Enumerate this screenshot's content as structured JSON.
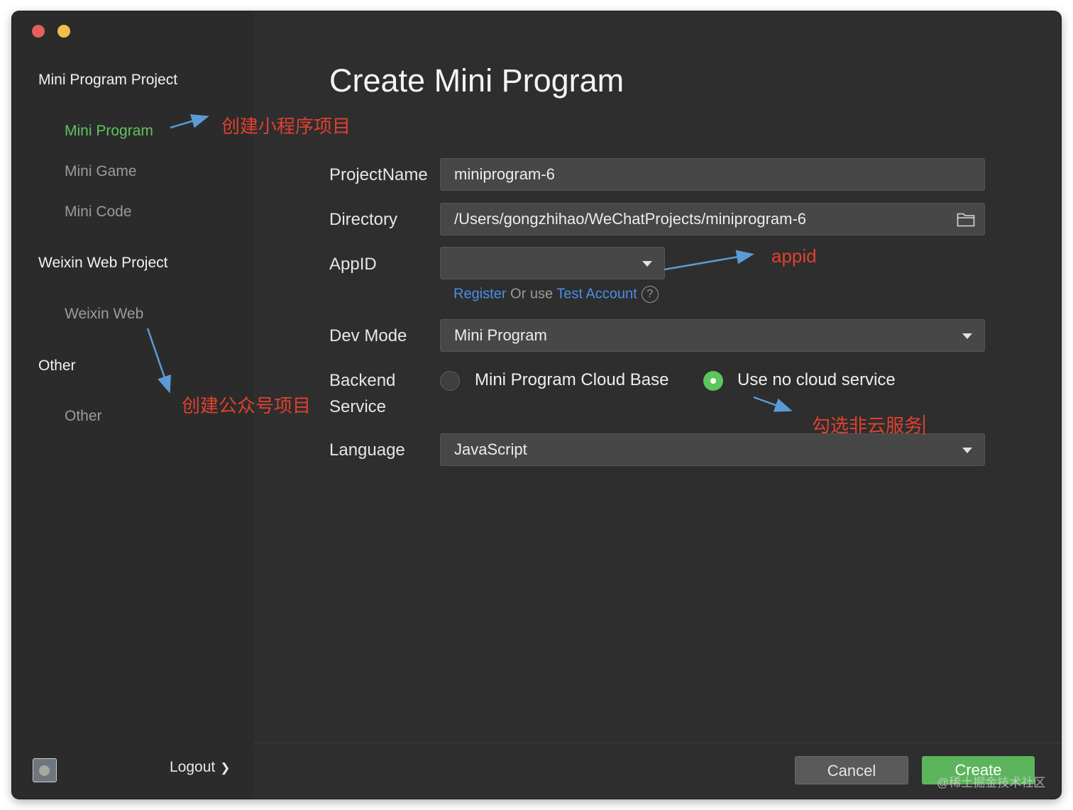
{
  "sidebar": {
    "groups": [
      {
        "title": "Mini Program Project",
        "items": [
          "Mini Program",
          "Mini Game",
          "Mini Code"
        ]
      },
      {
        "title": "Weixin Web Project",
        "items": [
          "Weixin Web"
        ]
      },
      {
        "title": "Other",
        "items": [
          "Other"
        ]
      }
    ],
    "active_item": "Mini Program",
    "logout_label": "Logout"
  },
  "form": {
    "title": "Create Mini Program",
    "project_name": {
      "label": "ProjectName",
      "value": "miniprogram-6"
    },
    "directory": {
      "label": "Directory",
      "value": "/Users/gongzhihao/WeChatProjects/miniprogram-6"
    },
    "appid": {
      "label": "AppID",
      "value": "",
      "hint_register": "Register",
      "hint_or_use": " Or use ",
      "hint_test_account": "Test Account",
      "help_glyph": "?"
    },
    "dev_mode": {
      "label": "Dev Mode",
      "value": "Mini Program"
    },
    "backend": {
      "label_line1": "Backend",
      "label_line2": "Service",
      "options": [
        "Mini Program Cloud Base",
        "Use no cloud service"
      ],
      "selected": "Use no cloud service"
    },
    "language": {
      "label": "Language",
      "value": "JavaScript"
    }
  },
  "buttons": {
    "cancel": "Cancel",
    "create": "Create"
  },
  "annotations": {
    "create_mini_program": "创建小程序项目",
    "appid": "appid",
    "create_official_account": "创建公众号项目",
    "no_cloud": "勾选非云服务"
  },
  "watermark": "@稀土掘金技术社区",
  "colors": {
    "window_bg": "#2e2e2e",
    "sidebar_bg": "#2b2b2b",
    "accent_green": "#5cc55c",
    "link_blue": "#4a8fe6",
    "annotation_red": "#e0402f",
    "arrow_blue": "#5b9bd5"
  },
  "icons": {
    "traffic_lights": [
      "close-light",
      "minimize-light"
    ],
    "directory_picker": "folder-icon",
    "dropdown": "chevron-down-icon",
    "help": "question-mark-icon",
    "logout": "chevron-right-icon"
  }
}
